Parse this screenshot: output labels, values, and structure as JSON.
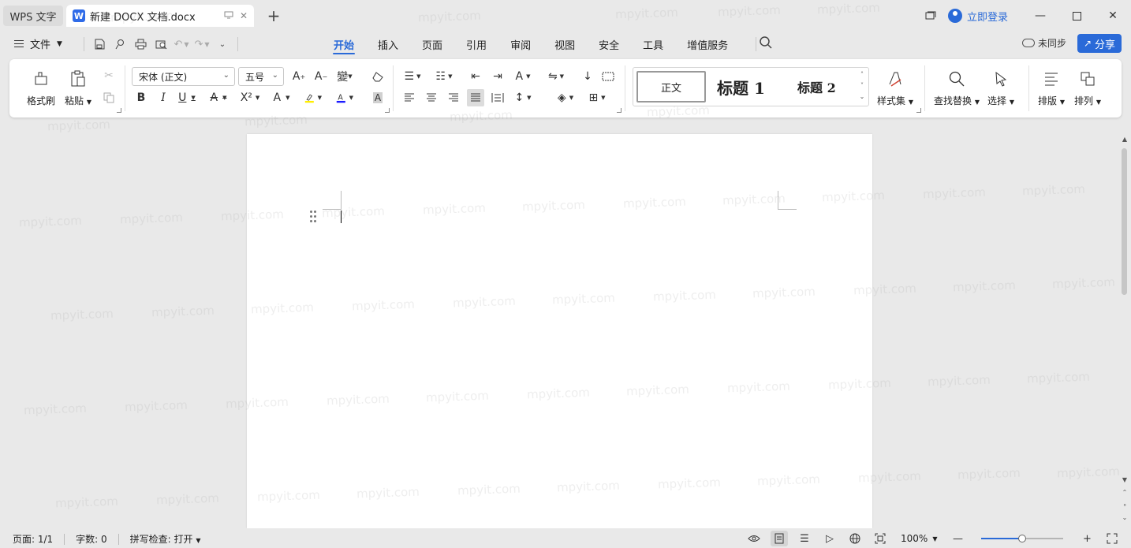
{
  "titlebar": {
    "home_tab": "WPS 文字",
    "doc_tab": "新建 DOCX 文档.docx",
    "doc_icon_letter": "W",
    "login": "立即登录"
  },
  "menubar": {
    "file": "文件",
    "tabs": [
      "开始",
      "插入",
      "页面",
      "引用",
      "审阅",
      "视图",
      "安全",
      "工具",
      "增值服务"
    ],
    "active_tab": "开始",
    "sync": "未同步",
    "share": "分享"
  },
  "ribbon": {
    "format_painter": "格式刷",
    "paste": "粘贴",
    "font_name": "宋体 (正文)",
    "font_size": "五号",
    "styles": {
      "normal": "正文",
      "heading1": "标题 1",
      "heading2": "标题 2"
    },
    "style_set": "样式集",
    "find_replace": "查找替换",
    "select": "选择",
    "layout": "排版",
    "arrange": "排列"
  },
  "watermark_text": "mpyit.com",
  "statusbar": {
    "page": "页面: 1/1",
    "words": "字数: 0",
    "spellcheck": "拼写检查: 打开",
    "zoom": "100%",
    "zoom_level": 0.5
  },
  "colors": {
    "accent": "#2a6ad8",
    "highlight": "#ffee00",
    "font_color": "#1a1aff"
  }
}
